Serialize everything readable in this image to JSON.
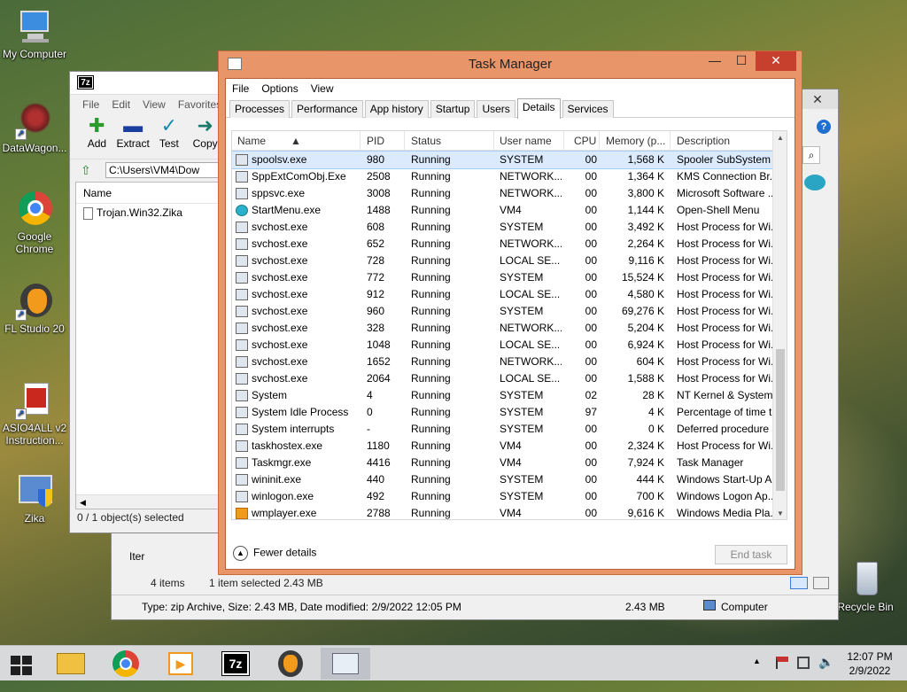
{
  "desktop_icons": [
    {
      "label": "My Computer"
    },
    {
      "label": "DataWagon..."
    },
    {
      "label": "Google Chrome"
    },
    {
      "label": "FL Studio 20"
    },
    {
      "label": "ASIO4ALL v2 Instruction..."
    },
    {
      "label": "Zika"
    },
    {
      "label": "Recycle Bin"
    }
  ],
  "sevenzip": {
    "logo": "7z",
    "menu": [
      "File",
      "Edit",
      "View",
      "Favorites"
    ],
    "tools": [
      {
        "label": "Add",
        "color": "#2a9a2a"
      },
      {
        "label": "Extract",
        "color": "#1a3ea0"
      },
      {
        "label": "Test",
        "color": "#1a8ab0"
      },
      {
        "label": "Copy",
        "color": "#1a7a6a"
      }
    ],
    "address": "C:\\Users\\VM4\\Dow",
    "column_name": "Name",
    "file_name": "Trojan.Win32.Zika",
    "status": "0 / 1 object(s) selected"
  },
  "explorer": {
    "items_count": "4 items",
    "selection": "1 item selected  2.43 MB",
    "side_label": "Iter",
    "details": "Type: zip Archive, Size: 2.43 MB, Date modified: 2/9/2022 12:05 PM",
    "size": "2.43 MB",
    "location": "Computer"
  },
  "taskmgr": {
    "title": "Task Manager",
    "menu": [
      "File",
      "Options",
      "View"
    ],
    "tabs": [
      "Processes",
      "Performance",
      "App history",
      "Startup",
      "Users",
      "Details",
      "Services"
    ],
    "active_tab": "Details",
    "columns": [
      "Name",
      "PID",
      "Status",
      "User name",
      "CPU",
      "Memory (p...",
      "Description"
    ],
    "rows": [
      {
        "name": "spoolsv.exe",
        "pid": "980",
        "status": "Running",
        "user": "SYSTEM",
        "cpu": "00",
        "mem": "1,568 K",
        "desc": "Spooler SubSystem ..."
      },
      {
        "name": "SppExtComObj.Exe",
        "pid": "2508",
        "status": "Running",
        "user": "NETWORK...",
        "cpu": "00",
        "mem": "1,364 K",
        "desc": "KMS Connection Br..."
      },
      {
        "name": "sppsvc.exe",
        "pid": "3008",
        "status": "Running",
        "user": "NETWORK...",
        "cpu": "00",
        "mem": "3,800 K",
        "desc": "Microsoft Software ..."
      },
      {
        "name": "StartMenu.exe",
        "pid": "1488",
        "status": "Running",
        "user": "VM4",
        "cpu": "00",
        "mem": "1,144 K",
        "desc": "Open-Shell Menu"
      },
      {
        "name": "svchost.exe",
        "pid": "608",
        "status": "Running",
        "user": "SYSTEM",
        "cpu": "00",
        "mem": "3,492 K",
        "desc": "Host Process for Wi..."
      },
      {
        "name": "svchost.exe",
        "pid": "652",
        "status": "Running",
        "user": "NETWORK...",
        "cpu": "00",
        "mem": "2,264 K",
        "desc": "Host Process for Wi..."
      },
      {
        "name": "svchost.exe",
        "pid": "728",
        "status": "Running",
        "user": "LOCAL SE...",
        "cpu": "00",
        "mem": "9,116 K",
        "desc": "Host Process for Wi..."
      },
      {
        "name": "svchost.exe",
        "pid": "772",
        "status": "Running",
        "user": "SYSTEM",
        "cpu": "00",
        "mem": "15,524 K",
        "desc": "Host Process for Wi..."
      },
      {
        "name": "svchost.exe",
        "pid": "912",
        "status": "Running",
        "user": "LOCAL SE...",
        "cpu": "00",
        "mem": "4,580 K",
        "desc": "Host Process for Wi..."
      },
      {
        "name": "svchost.exe",
        "pid": "960",
        "status": "Running",
        "user": "SYSTEM",
        "cpu": "00",
        "mem": "69,276 K",
        "desc": "Host Process for Wi..."
      },
      {
        "name": "svchost.exe",
        "pid": "328",
        "status": "Running",
        "user": "NETWORK...",
        "cpu": "00",
        "mem": "5,204 K",
        "desc": "Host Process for Wi..."
      },
      {
        "name": "svchost.exe",
        "pid": "1048",
        "status": "Running",
        "user": "LOCAL SE...",
        "cpu": "00",
        "mem": "6,924 K",
        "desc": "Host Process for Wi..."
      },
      {
        "name": "svchost.exe",
        "pid": "1652",
        "status": "Running",
        "user": "NETWORK...",
        "cpu": "00",
        "mem": "604 K",
        "desc": "Host Process for Wi..."
      },
      {
        "name": "svchost.exe",
        "pid": "2064",
        "status": "Running",
        "user": "LOCAL SE...",
        "cpu": "00",
        "mem": "1,588 K",
        "desc": "Host Process for Wi..."
      },
      {
        "name": "System",
        "pid": "4",
        "status": "Running",
        "user": "SYSTEM",
        "cpu": "02",
        "mem": "28 K",
        "desc": "NT Kernel & System"
      },
      {
        "name": "System Idle Process",
        "pid": "0",
        "status": "Running",
        "user": "SYSTEM",
        "cpu": "97",
        "mem": "4 K",
        "desc": "Percentage of time t..."
      },
      {
        "name": "System interrupts",
        "pid": "-",
        "status": "Running",
        "user": "SYSTEM",
        "cpu": "00",
        "mem": "0 K",
        "desc": "Deferred procedure ..."
      },
      {
        "name": "taskhostex.exe",
        "pid": "1180",
        "status": "Running",
        "user": "VM4",
        "cpu": "00",
        "mem": "2,324 K",
        "desc": "Host Process for Wi..."
      },
      {
        "name": "Taskmgr.exe",
        "pid": "4416",
        "status": "Running",
        "user": "VM4",
        "cpu": "00",
        "mem": "7,924 K",
        "desc": "Task Manager"
      },
      {
        "name": "wininit.exe",
        "pid": "440",
        "status": "Running",
        "user": "SYSTEM",
        "cpu": "00",
        "mem": "444 K",
        "desc": "Windows Start-Up A..."
      },
      {
        "name": "winlogon.exe",
        "pid": "492",
        "status": "Running",
        "user": "SYSTEM",
        "cpu": "00",
        "mem": "700 K",
        "desc": "Windows Logon Ap..."
      },
      {
        "name": "wmplayer.exe",
        "pid": "2788",
        "status": "Running",
        "user": "VM4",
        "cpu": "00",
        "mem": "9,616 K",
        "desc": "Windows Media Pla..."
      }
    ],
    "fewer_details": "Fewer details",
    "end_task": "End task"
  },
  "taskbar": {
    "time": "12:07 PM",
    "date": "2/9/2022",
    "sevenzip_label": "7z"
  }
}
